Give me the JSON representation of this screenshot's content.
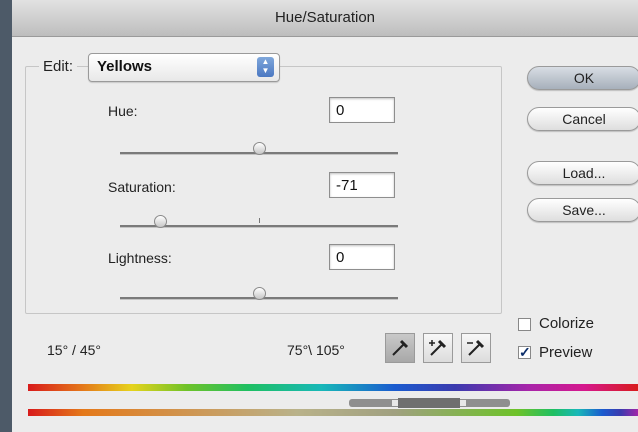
{
  "window": {
    "title": "Hue/Saturation"
  },
  "edit": {
    "label": "Edit:",
    "selected": "Yellows"
  },
  "sliders": {
    "hue": {
      "label": "Hue:",
      "value": "0",
      "level": 0
    },
    "saturation": {
      "label": "Saturation:",
      "value": "-71",
      "level": -71
    },
    "lightness": {
      "label": "Lightness:",
      "value": "0",
      "level": 0
    }
  },
  "buttons": {
    "ok": "OK",
    "cancel": "Cancel",
    "load": "Load...",
    "save": "Save..."
  },
  "options": {
    "colorize": {
      "label": "Colorize",
      "checked": false
    },
    "preview": {
      "label": "Preview",
      "checked": true
    }
  },
  "ranges": {
    "left": "15° / 45°",
    "right": "75°\\ 105°"
  },
  "icons": [
    "eyedropper-icon",
    "eyedropper-plus-icon",
    "eyedropper-minus-icon"
  ],
  "colors": {
    "title_bar": "#c8c8c8",
    "dialog_bg": "#ececec",
    "desktop": "#4d5a68"
  }
}
